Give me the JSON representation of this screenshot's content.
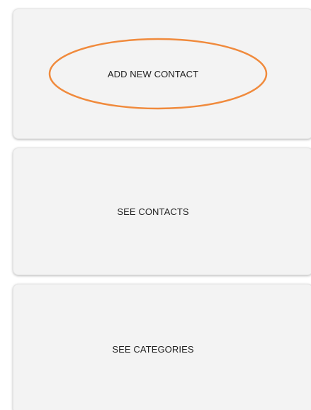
{
  "menu": {
    "items": [
      {
        "label": "ADD NEW CONTACT"
      },
      {
        "label": "SEE CONTACTS"
      },
      {
        "label": "SEE CATEGORIES"
      }
    ]
  },
  "colors": {
    "card_background": "#f3f3f3",
    "highlight": "#f08a3c",
    "text": "#1f1f1f"
  }
}
